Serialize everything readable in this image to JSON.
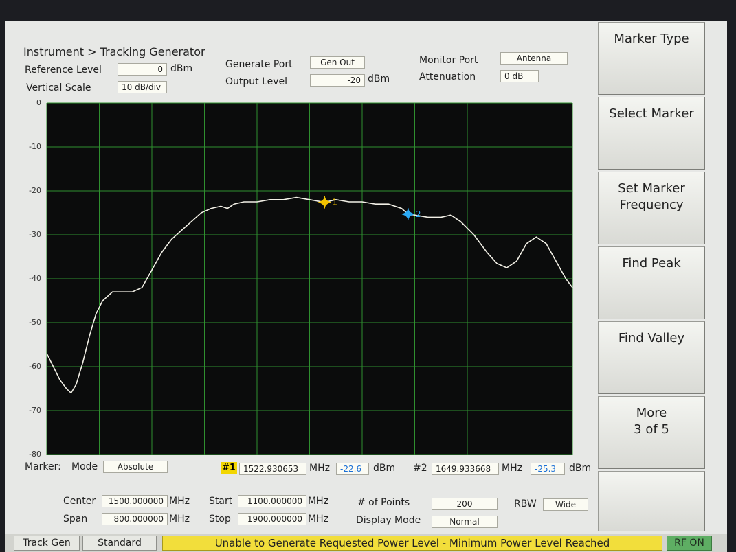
{
  "header": {
    "breadcrumb": "Instrument > Tracking Generator",
    "reference_level_label": "Reference Level",
    "reference_level_value": "0",
    "reference_level_unit": "dBm",
    "vertical_scale_label": "Vertical Scale",
    "vertical_scale_value": "10 dB/div",
    "generate_port_label": "Generate Port",
    "generate_port_value": "Gen Out",
    "output_level_label": "Output Level",
    "output_level_value": "-20",
    "output_level_unit": "dBm",
    "monitor_port_label": "Monitor Port",
    "monitor_port_value": "Antenna",
    "attenuation_label": "Attenuation",
    "attenuation_value": "0 dB"
  },
  "chart_data": {
    "type": "line",
    "y_ticks": [
      "0",
      "-10",
      "-20",
      "-30",
      "-40",
      "-50",
      "-60",
      "-70",
      "-80"
    ],
    "ylim": [
      -80,
      0
    ],
    "xlim": [
      1100,
      1900
    ],
    "grid": true,
    "x": [
      1100,
      1110,
      1120,
      1130,
      1137,
      1145,
      1155,
      1165,
      1175,
      1185,
      1200,
      1215,
      1230,
      1245,
      1260,
      1275,
      1290,
      1305,
      1320,
      1335,
      1350,
      1365,
      1375,
      1385,
      1400,
      1420,
      1440,
      1460,
      1480,
      1500,
      1522.93,
      1540,
      1560,
      1580,
      1600,
      1620,
      1640,
      1649.93,
      1660,
      1680,
      1700,
      1715,
      1730,
      1750,
      1770,
      1785,
      1800,
      1815,
      1830,
      1845,
      1860,
      1875,
      1890,
      1900
    ],
    "y": [
      -57,
      -60,
      -63,
      -65,
      -66,
      -64,
      -59,
      -53,
      -48,
      -45,
      -43,
      -43,
      -43,
      -42,
      -38,
      -34,
      -31,
      -29,
      -27,
      -25,
      -24,
      -23.5,
      -24,
      -23,
      -22.5,
      -22.5,
      -22,
      -22,
      -21.5,
      -22,
      -22.6,
      -22,
      -22.5,
      -22.5,
      -23,
      -23,
      -24,
      -25.3,
      -25.5,
      -26,
      -26,
      -25.5,
      -27,
      -30,
      -34,
      -36.5,
      -37.5,
      -36,
      -32,
      -30.5,
      -32,
      -36,
      -40,
      -42
    ]
  },
  "markers": [
    {
      "label": "1",
      "x": 1522.93,
      "y": -22.6,
      "color": "#f2c200"
    },
    {
      "label": "2",
      "x": 1649.93,
      "y": -25.3,
      "color": "#2aa9f5"
    }
  ],
  "marker_bar": {
    "label": "Marker:",
    "mode_label": "Mode",
    "mode_value": "Absolute",
    "m1_tag": "#1",
    "m1_freq": "1522.930653",
    "m1_freq_unit": "MHz",
    "m1_level": "-22.6",
    "m1_level_unit": "dBm",
    "m2_tag": "#2",
    "m2_freq": "1649.933668",
    "m2_freq_unit": "MHz",
    "m2_level": "-25.3",
    "m2_level_unit": "dBm"
  },
  "settings": {
    "center_label": "Center",
    "center_value": "1500.000000",
    "span_label": "Span",
    "span_value": "800.000000",
    "start_label": "Start",
    "start_value": "1100.000000",
    "stop_label": "Stop",
    "stop_value": "1900.000000",
    "unit": "MHz",
    "points_label": "# of Points",
    "points_value": "200",
    "display_mode_label": "Display Mode",
    "display_mode_value": "Normal",
    "rbw_label": "RBW",
    "rbw_value": "Wide"
  },
  "softkeys": {
    "k1": [
      "Marker Type"
    ],
    "k2": [
      "Select Marker"
    ],
    "k3": [
      "Set Marker",
      "Frequency"
    ],
    "k4": [
      "Find Peak"
    ],
    "k5": [
      "Find Valley"
    ],
    "k6": [
      "More",
      "3 of 5"
    ]
  },
  "status": {
    "tab1": "Track Gen",
    "tab2": "Standard",
    "message": "Unable to Generate Requested Power Level - Minimum Power Level Reached",
    "rf": "RF ON"
  },
  "colors": {
    "plot_bg": "#0b0c0c",
    "grid": "#2f8f2f",
    "trace": "#f2f0e6"
  }
}
